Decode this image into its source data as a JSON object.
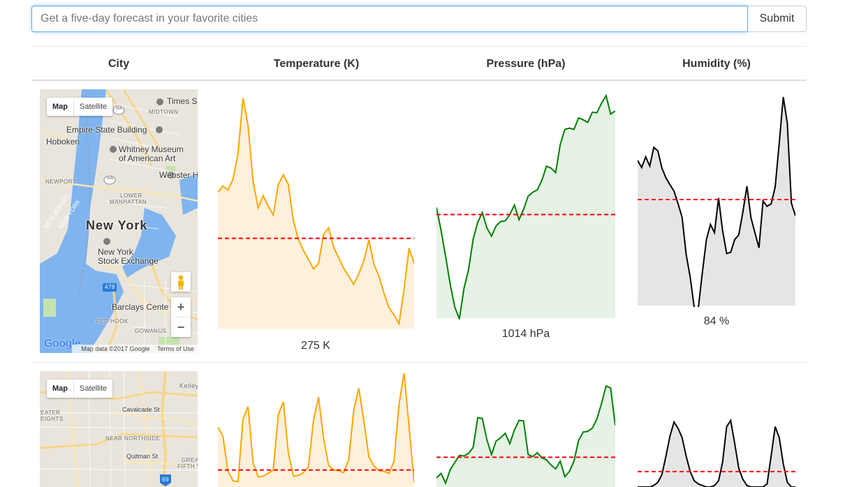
{
  "search": {
    "placeholder": "Get a five-day forecast in your favorite cities",
    "submit_label": "Submit"
  },
  "table": {
    "headers": [
      "City",
      "Temperature (K)",
      "Pressure (hPa)",
      "Humidity (%)"
    ]
  },
  "map_controls": {
    "map_label": "Map",
    "satellite_label": "Satellite",
    "zoom_in": "+",
    "zoom_out": "−",
    "attribution": "Map data ©2017 Google",
    "terms": "Terms of Use",
    "logo": "Google"
  },
  "rows": [
    {
      "map_labels": {
        "city": "New York",
        "times_sq": "Times S",
        "midtown": "MIDTOWN",
        "empire": "Empire State Building",
        "hoboken": "Hoboken",
        "whitney": "Whitney Museum",
        "whitney2": "of American Art",
        "webster": "Webster H",
        "newport": "NEWPORT",
        "lower_manhattan": "LOWER",
        "lower_manhattan2": "MANHATTAN",
        "nyse": "New York",
        "nyse2": "Stock Exchange",
        "barclays": "Barclays Cente",
        "red_hook": "RED HOOK",
        "gowanus": "GOWANUS",
        "new_jersey": "NEW JERSEY",
        "new_york_state": "NEW YORK",
        "route_9a": "9A",
        "route_478": "478"
      },
      "temperature_label": "275 K",
      "pressure_label": "1014 hPa",
      "humidity_label": "84 %"
    },
    {
      "map_labels": {
        "cavalcade": "Cavalcade St",
        "near_northside": "NEAR NORTHSIDE",
        "quitman": "Quitman St",
        "eater_heights": "EATER",
        "eater_heights2": "EIGHTS",
        "kelley": "Kelley",
        "fifth_ward": "GREA",
        "fifth_ward2": "FIFTH W",
        "route_69": "69"
      }
    }
  ],
  "colors": {
    "temperature": "#ffa500",
    "temperature_fill": "#fdf1dc",
    "pressure": "#008000",
    "pressure_fill": "#e5f2e5",
    "humidity": "#000000",
    "humidity_fill": "#e5e5e5",
    "mean_line": "#ff0000",
    "water": "#7fb4ef",
    "land": "#e9e5dc"
  },
  "chart_data": [
    {
      "type": "area",
      "name": "temperature-row-1",
      "x": [
        0,
        1,
        2,
        3,
        4,
        5,
        6,
        7,
        8,
        9,
        10,
        11,
        12,
        13,
        14,
        15,
        16,
        17,
        18,
        19,
        20,
        21,
        22,
        23,
        24,
        25,
        26,
        27,
        28,
        29,
        30,
        31,
        32,
        33,
        34,
        35,
        36,
        37,
        38,
        39
      ],
      "values": [
        281.0,
        281.8,
        281.3,
        282.6,
        285.8,
        292.7,
        289.3,
        282.4,
        279.1,
        280.6,
        279.3,
        278.2,
        282.0,
        283.2,
        282.0,
        277.5,
        275.2,
        273.8,
        272.7,
        271.5,
        272.2,
        275.8,
        276.6,
        274.2,
        272.9,
        271.6,
        270.6,
        269.6,
        270.9,
        272.5,
        275.1,
        272.1,
        270.6,
        268.5,
        266.7,
        265.8,
        264.7,
        269.0,
        274.1,
        272.2
      ],
      "mean": 275.3,
      "ylim": [
        264.1,
        293.8
      ]
    },
    {
      "type": "area",
      "name": "pressure-row-1",
      "x": [
        0,
        1,
        2,
        3,
        4,
        5,
        6,
        7,
        8,
        9,
        10,
        11,
        12,
        13,
        14,
        15,
        16,
        17,
        18,
        19,
        20,
        21,
        22,
        23,
        24,
        25,
        26,
        27,
        28,
        29,
        30,
        31,
        32,
        33,
        34,
        35,
        36,
        37,
        38,
        39
      ],
      "values": [
        1015.8,
        1012.2,
        1008.1,
        1003.7,
        1000.1,
        998.3,
        1003.1,
        1006.0,
        1010.8,
        1013.5,
        1015.0,
        1012.6,
        1011.3,
        1012.9,
        1013.6,
        1013.7,
        1014.7,
        1016.2,
        1013.9,
        1015.5,
        1017.6,
        1018.2,
        1018.6,
        1020.1,
        1022.3,
        1022.0,
        1021.3,
        1025.7,
        1028.1,
        1028.3,
        1028.1,
        1029.9,
        1029.6,
        1029.2,
        1030.8,
        1030.7,
        1032.2,
        1033.4,
        1030.5,
        1031.0
      ],
      "mean": 1014.7,
      "ylim": [
        998.4,
        1034.4
      ]
    },
    {
      "type": "area",
      "name": "humidity-row-1",
      "x": [
        0,
        1,
        2,
        3,
        4,
        5,
        6,
        7,
        8,
        9,
        10,
        11,
        12,
        13,
        14,
        15,
        16,
        17,
        18,
        19,
        20,
        21,
        22,
        23,
        24,
        25,
        26,
        27,
        28,
        29,
        30,
        31,
        32,
        33,
        34,
        35,
        36,
        37,
        38,
        39
      ],
      "values": [
        90.0,
        87.6,
        91.2,
        88.1,
        94.4,
        93.2,
        87.4,
        84.1,
        81.8,
        79.6,
        75.4,
        70.8,
        58.3,
        50.6,
        40.3,
        40.1,
        52.1,
        63.2,
        68.4,
        65.6,
        77.3,
        66.3,
        58.6,
        59.0,
        63.3,
        64.9,
        72.5,
        81.3,
        70.7,
        65.5,
        60.5,
        76.3,
        74.5,
        75.3,
        81.0,
        95.8,
        111.4,
        102.5,
        75.6,
        71.3
      ],
      "mean": 76.8,
      "ylim": [
        41.0,
        114.0
      ]
    },
    {
      "type": "area",
      "name": "temperature-row-2",
      "x": [
        0,
        1,
        2,
        3,
        4,
        5,
        6,
        7,
        8,
        9,
        10,
        11,
        12,
        13,
        14,
        15,
        16,
        17,
        18,
        19,
        20,
        21,
        22,
        23,
        24,
        25,
        26,
        27,
        28,
        29,
        30,
        31,
        32,
        33,
        34,
        35,
        36,
        37,
        38,
        39
      ],
      "values": [
        296.8,
        295.5,
        290.3,
        288.9,
        288.8,
        298.0,
        299.8,
        291.6,
        289.5,
        289.6,
        290.0,
        290.5,
        298.6,
        300.5,
        293.0,
        289.6,
        289.7,
        290.1,
        291.0,
        297.8,
        301.2,
        295.2,
        291.2,
        290.5,
        290.4,
        290.1,
        292.0,
        299.3,
        302.5,
        297.8,
        292.4,
        291.1,
        290.4,
        290.3,
        290.0,
        291.8,
        300.2,
        304.7,
        296.8,
        288.7
      ],
      "mean": 290.5,
      "ylim": [
        288.0,
        305.0
      ]
    },
    {
      "type": "area",
      "name": "pressure-row-2",
      "x": [
        0,
        1,
        2,
        3,
        4,
        5,
        6,
        7,
        8,
        9,
        10,
        11,
        12,
        13,
        14,
        15,
        16,
        17,
        18,
        19,
        20,
        21,
        22,
        23,
        24,
        25,
        26,
        27,
        28,
        29,
        30,
        31,
        32,
        33,
        34,
        35,
        36,
        37,
        38,
        39
      ],
      "values": [
        1011.4,
        1012.1,
        1010.6,
        1012.7,
        1013.8,
        1014.9,
        1014.8,
        1015.2,
        1016.1,
        1020.7,
        1020.6,
        1017.3,
        1015.0,
        1017.1,
        1017.6,
        1018.3,
        1016.7,
        1018.8,
        1020.3,
        1020.2,
        1015.0,
        1014.7,
        1015.3,
        1014.5,
        1014.2,
        1013.4,
        1012.8,
        1014.0,
        1011.6,
        1012.4,
        1014.0,
        1017.2,
        1018.5,
        1018.6,
        1019.1,
        1020.5,
        1022.9,
        1025.6,
        1025.3,
        1019.5
      ],
      "mean": 1014.6,
      "ylim": [
        1010.0,
        1026.5
      ]
    },
    {
      "type": "area",
      "name": "humidity-row-2",
      "x": [
        0,
        1,
        2,
        3,
        4,
        5,
        6,
        7,
        8,
        9,
        10,
        11,
        12,
        13,
        14,
        15,
        16,
        17,
        18,
        19,
        20,
        21,
        22,
        23,
        24,
        25,
        26,
        27,
        28,
        29,
        30,
        31,
        32,
        33,
        34,
        35,
        36,
        37,
        38,
        39
      ],
      "values": [
        40.0,
        40.0,
        40.0,
        40.0,
        41.0,
        43.0,
        48.0,
        60.0,
        73.0,
        82.0,
        78.0,
        72.0,
        60.0,
        50.0,
        44.0,
        42.0,
        41.0,
        40.0,
        40.0,
        41.0,
        44.0,
        56.0,
        79.0,
        83.0,
        68.0,
        52.0,
        45.0,
        41.0,
        40.0,
        40.0,
        40.0,
        40.0,
        42.0,
        60.0,
        79.0,
        72.0,
        55.0,
        43.0,
        40.0,
        40.0
      ],
      "mean": 50.0,
      "ylim": [
        40.0,
        100.0
      ]
    }
  ]
}
